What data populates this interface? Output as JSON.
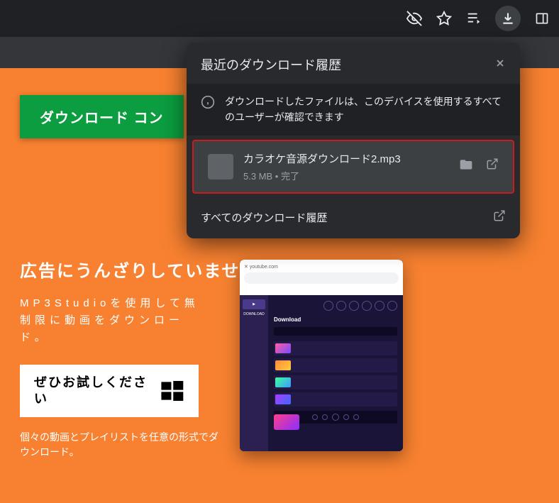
{
  "page": {
    "download_button": "ダウンロード コン",
    "promo": {
      "heading": "広告にうんざりしていませんか？",
      "subheading": "MP3Studioを使用して無制限に動画をダウンロード。",
      "try_button": "ぜひお試しください",
      "footer": "個々の動画とプレイリストを任意の形式でダウンロード。"
    },
    "preview": {
      "title": "Download"
    }
  },
  "downloads_popup": {
    "title": "最近のダウンロード履歴",
    "info_text": "ダウンロードしたファイルは、このデバイスを使用するすべてのユーザーが確認できます",
    "items": [
      {
        "filename": "カラオケ音源ダウンロード2.mp3",
        "size": "5.3 MB",
        "status": "完了"
      }
    ],
    "footer_link": "すべてのダウンロード履歴"
  }
}
